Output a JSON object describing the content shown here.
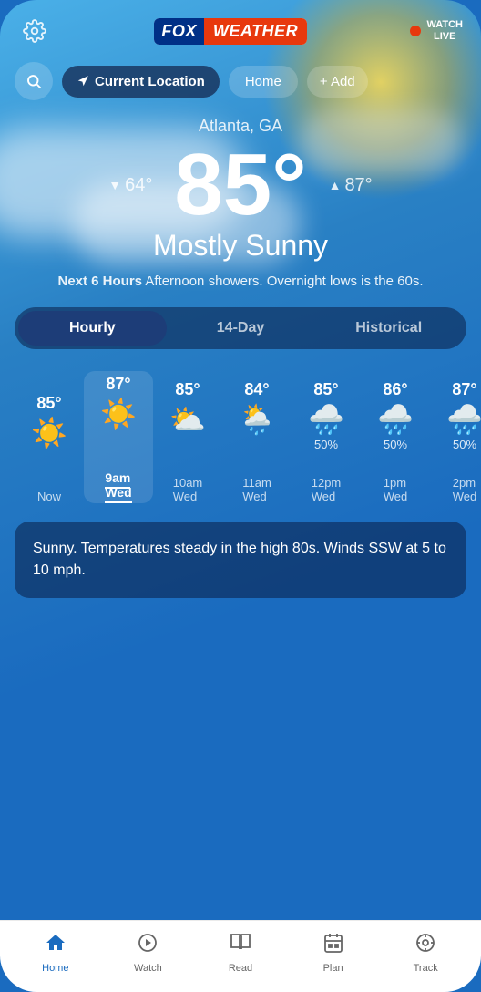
{
  "app": {
    "title": "Fox Weather"
  },
  "header": {
    "logo_fox": "FOX",
    "logo_weather": "WEATHER",
    "watch_live_label": "WATCH\nLIVE"
  },
  "location_bar": {
    "current_location_label": "Current Location",
    "home_label": "Home",
    "add_label": "+ Add"
  },
  "weather": {
    "city": "Atlanta, GA",
    "temp_main": "85°",
    "temp_low": "64°",
    "temp_high": "87°",
    "condition": "Mostly Sunny",
    "forecast_bold": "Next 6 Hours",
    "forecast_text": " Afternoon showers. Overnight lows is the 60s."
  },
  "tabs": [
    {
      "label": "Hourly",
      "active": true
    },
    {
      "label": "14-Day",
      "active": false
    },
    {
      "label": "Historical",
      "active": false
    }
  ],
  "hourly": [
    {
      "temp": "85°",
      "icon": "sunny",
      "precip": "",
      "time": "Now",
      "bold": false
    },
    {
      "temp": "87°",
      "icon": "sunny",
      "precip": "",
      "time": "9am",
      "sub": "Wed",
      "bold": true
    },
    {
      "temp": "85°",
      "icon": "partly",
      "precip": "",
      "time": "10am",
      "sub": "Wed",
      "bold": false
    },
    {
      "temp": "84°",
      "icon": "partly-rain",
      "precip": "",
      "time": "11am",
      "sub": "Wed",
      "bold": false
    },
    {
      "temp": "85°",
      "icon": "rain",
      "precip": "50%",
      "time": "12pm",
      "sub": "Wed",
      "bold": false
    },
    {
      "temp": "86°",
      "icon": "rain",
      "precip": "50%",
      "time": "1pm",
      "sub": "Wed",
      "bold": false
    },
    {
      "temp": "87°",
      "icon": "rain",
      "precip": "50%",
      "time": "2pm",
      "sub": "Wed",
      "bold": false
    }
  ],
  "summary": {
    "text": "Sunny. Temperatures steady in the high 80s. Winds SSW at 5 to 10 mph."
  },
  "bottom_nav": [
    {
      "label": "Home",
      "icon": "home",
      "active": true
    },
    {
      "label": "Watch",
      "icon": "watch",
      "active": false
    },
    {
      "label": "Read",
      "icon": "read",
      "active": false
    },
    {
      "label": "Plan",
      "icon": "plan",
      "active": false
    },
    {
      "label": "Track",
      "icon": "track",
      "active": false
    }
  ]
}
